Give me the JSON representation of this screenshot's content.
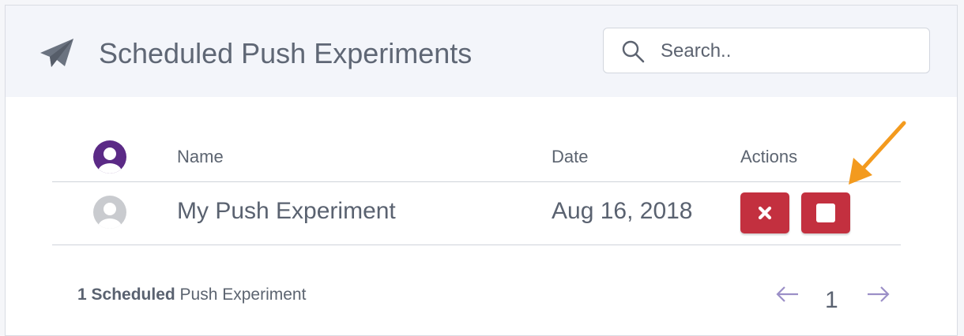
{
  "header": {
    "title": "Scheduled Push Experiments",
    "icon": "paper-plane-icon"
  },
  "search": {
    "placeholder": "Search..",
    "value": "",
    "icon": "search-icon"
  },
  "table": {
    "columns": {
      "avatar_icon": "user-avatar-icon",
      "name": "Name",
      "date": "Date",
      "actions": "Actions"
    },
    "rows": [
      {
        "avatar_icon": "user-avatar-icon",
        "name": "My Push Experiment",
        "date": "Aug 16, 2018",
        "actions": [
          "delete-x-icon",
          "stop-square-icon"
        ]
      }
    ]
  },
  "footer": {
    "count_bold": "1 Scheduled",
    "count_rest": " Push Experiment",
    "page": "1"
  },
  "colors": {
    "accent_purple": "#5b2a86",
    "danger_red": "#c3303f",
    "callout_orange": "#f39a1e",
    "pager_arrow": "#9b8fc7"
  }
}
